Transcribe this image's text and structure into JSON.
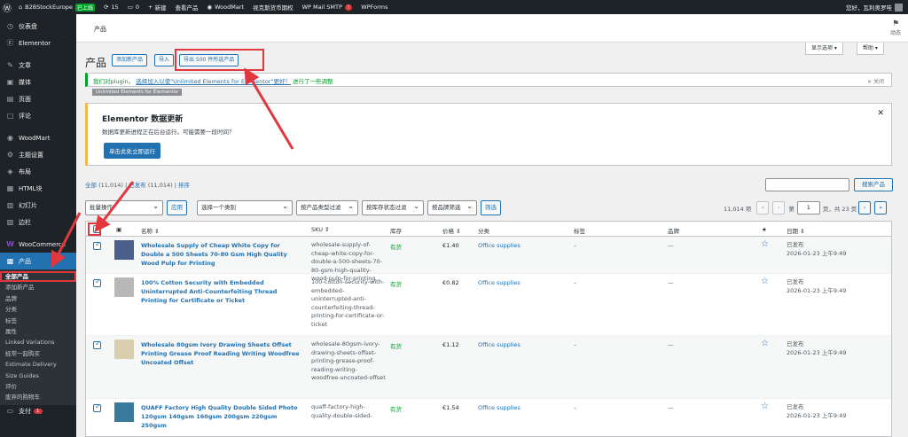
{
  "adminbar": {
    "site": "B2BStockEurope",
    "site_badge": "已上线",
    "updates": "15",
    "comments": "0",
    "new": "新建",
    "view_products": "查看产品",
    "woodmart": "WoodMart",
    "plugin_link": "视克斯货币期权",
    "smtp": "WP Mail SMTP",
    "smtp_badge": "!",
    "wpforms": "WPForms",
    "greeting": "您好，瓦利奥罗哇"
  },
  "sidebar": {
    "items": [
      {
        "label": "仪表盘",
        "icon": "dashboard-icon",
        "glyph": "◷"
      },
      {
        "label": "Elementor",
        "icon": "elementor-icon",
        "glyph": "Ⓔ"
      },
      {
        "label": "文章",
        "icon": "pin-icon",
        "glyph": "✎"
      },
      {
        "label": "媒体",
        "icon": "media-icon",
        "glyph": "▣"
      },
      {
        "label": "页面",
        "icon": "page-icon",
        "glyph": "▤"
      },
      {
        "label": "评论",
        "icon": "comment-icon",
        "glyph": "▢"
      },
      {
        "label": "WoodMart",
        "icon": "woodmart-icon",
        "glyph": "◉"
      },
      {
        "label": "主题设置",
        "icon": "settings-icon",
        "glyph": "⚙"
      },
      {
        "label": "布局",
        "icon": "layout-icon",
        "glyph": "◈"
      },
      {
        "label": "HTML块",
        "icon": "html-icon",
        "glyph": "▦"
      },
      {
        "label": "幻灯片",
        "icon": "slides-icon",
        "glyph": "▥"
      },
      {
        "label": "边栏",
        "icon": "sidebar-icon",
        "glyph": "▧"
      },
      {
        "label": "WooCommerce",
        "icon": "woocommerce-icon",
        "glyph": "W"
      },
      {
        "label": "产品",
        "icon": "products-icon",
        "glyph": "▩"
      }
    ],
    "submenu": [
      "全部产品",
      "添加新产品",
      "品牌",
      "分类",
      "标签",
      "属性",
      "Linked Variations",
      "经常一起购买",
      "Estimate Delivery",
      "Size Guides",
      "评价",
      "废弃的购物车"
    ],
    "bottom_label": "支付",
    "bottom_badge": "1"
  },
  "header": {
    "title": "产品",
    "activity": "动态"
  },
  "screen_options": "显示选项 ▾",
  "help": "帮助 ▾",
  "page": {
    "title": "产品",
    "add_new": "添加新产品",
    "import": "导入",
    "export": "导出 500 件所选产品"
  },
  "notice_green": {
    "prefix": "我们对plugin。",
    "link": "选择加入以使\"Unlimited Elements for Elementor\"更好！",
    "suffix": "进行了一些调整",
    "dismiss": "✕ 关闭",
    "tag": "Unlimited Elements for Elementor"
  },
  "notice_elementor": {
    "title": "Elementor 数据更新",
    "text": "数据库更新进程正在后台运行。可能需要一段时间？",
    "button": "单击此处立即运行",
    "close": "✕"
  },
  "views": {
    "all": "全部",
    "all_count": "(11,014)",
    "published": "已发布",
    "published_count": "(11,014)",
    "sort": "排序",
    "sep": "|"
  },
  "search_button": "搜索产品",
  "filters": {
    "bulk": "批量操作",
    "apply": "应用",
    "category": "选择一个类别",
    "type": "按产品类型过滤",
    "stock": "按库存状态过滤",
    "brand": "按品牌筛选",
    "filter": "筛选"
  },
  "pagination": {
    "items": "11,014 项",
    "first": "«",
    "prev": "‹",
    "page_label": "第",
    "current": "1",
    "of": "页，共 23 页",
    "next": "›",
    "last": "»"
  },
  "table": {
    "columns": {
      "name": "名称 ⇕",
      "sku": "SKU ⇕",
      "stock": "库存",
      "price": "价格 ⇕",
      "category": "分类",
      "tags": "标签",
      "brands": "品牌",
      "featured": "★",
      "date": "日期 ⇕"
    },
    "rows": [
      {
        "name": "Wholesale Supply of Cheap White Copy for Double a 500 Sheets 70-80 Gsm High Quality Wood Pulp for Printing",
        "sku": "wholesale-supply-of-cheap-white-copy-for-double-a-500-sheets-70-80-gsm-high-quality-wood-pulp-for-printing",
        "stock": "有货",
        "price": "€1.40",
        "category": "Office supplies",
        "tags": "–",
        "brands": "—",
        "status": "已发布",
        "date": "2026-01-23 上午9:49"
      },
      {
        "name": "100% Cotton Security with Embedded Uninterrupted Anti-Counterfeiting Thread Printing for Certificate or Ticket",
        "sku": "100-cotton-security-with-embedded-uninterrupted-anti-counterfeiting-thread-printing-for-certificate-or-ticket",
        "stock": "有货",
        "price": "€0.82",
        "category": "Office supplies",
        "tags": "–",
        "brands": "—",
        "status": "已发布",
        "date": "2026-01-23 上午9:49"
      },
      {
        "name": "Wholesale 80gsm Ivory Drawing Sheets Offset Printing Grease Proof Reading Writing Woodfree Uncoated Offset",
        "sku": "wholesale-80gsm-ivory-drawing-sheets-offset-printing-grease-proof-reading-writing-woodfree-uncoated-offset",
        "stock": "有货",
        "price": "€1.12",
        "category": "Office supplies",
        "tags": "–",
        "brands": "—",
        "status": "已发布",
        "date": "2026-01-23 上午9:49"
      },
      {
        "name": "QUAFF Factory High Quality Double Sided Photo 120gsm 140gsm 160gsm 200gsm 220gsm 250gsm",
        "sku": "quaff-factory-high-quality-double-sided-",
        "stock": "有货",
        "price": "€1.54",
        "category": "Office supplies",
        "tags": "–",
        "brands": "—",
        "status": "已发布",
        "date": "2026-01-23 上午9:49"
      }
    ]
  },
  "colors": {
    "accent": "#2271b1",
    "annotation": "#e0383e",
    "stock": "#00a32a"
  }
}
